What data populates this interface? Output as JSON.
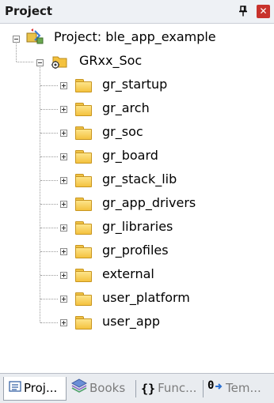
{
  "panel": {
    "title": "Project",
    "pin_icon": "pin-icon",
    "close_icon": "close-icon",
    "close_color": "#c8322c"
  },
  "tree": {
    "root": {
      "label": "Project: ble_app_example",
      "icon": "project-icon",
      "expanded": true
    },
    "target": {
      "label": "GRxx_Soc",
      "icon": "target-folder-icon",
      "expanded": true
    },
    "groups": [
      {
        "label": "gr_startup",
        "icon": "folder-icon",
        "expanded": false
      },
      {
        "label": "gr_arch",
        "icon": "folder-icon",
        "expanded": false
      },
      {
        "label": "gr_soc",
        "icon": "folder-icon",
        "expanded": false
      },
      {
        "label": "gr_board",
        "icon": "folder-icon",
        "expanded": false
      },
      {
        "label": "gr_stack_lib",
        "icon": "folder-icon",
        "expanded": false
      },
      {
        "label": "gr_app_drivers",
        "icon": "folder-icon",
        "expanded": false
      },
      {
        "label": "gr_libraries",
        "icon": "folder-icon",
        "expanded": false
      },
      {
        "label": "gr_profiles",
        "icon": "folder-icon",
        "expanded": false
      },
      {
        "label": "external",
        "icon": "folder-icon",
        "expanded": false
      },
      {
        "label": "user_platform",
        "icon": "folder-icon",
        "expanded": false
      },
      {
        "label": "user_app",
        "icon": "folder-icon",
        "expanded": false
      }
    ]
  },
  "tabs": [
    {
      "label": "Proj...",
      "icon": "project-tab-icon",
      "active": true
    },
    {
      "label": "Books",
      "icon": "books-icon",
      "active": false
    },
    {
      "label": "Func...",
      "icon": "functions-icon",
      "active": false
    },
    {
      "label": "Tem...",
      "icon": "templates-icon",
      "active": false
    }
  ]
}
